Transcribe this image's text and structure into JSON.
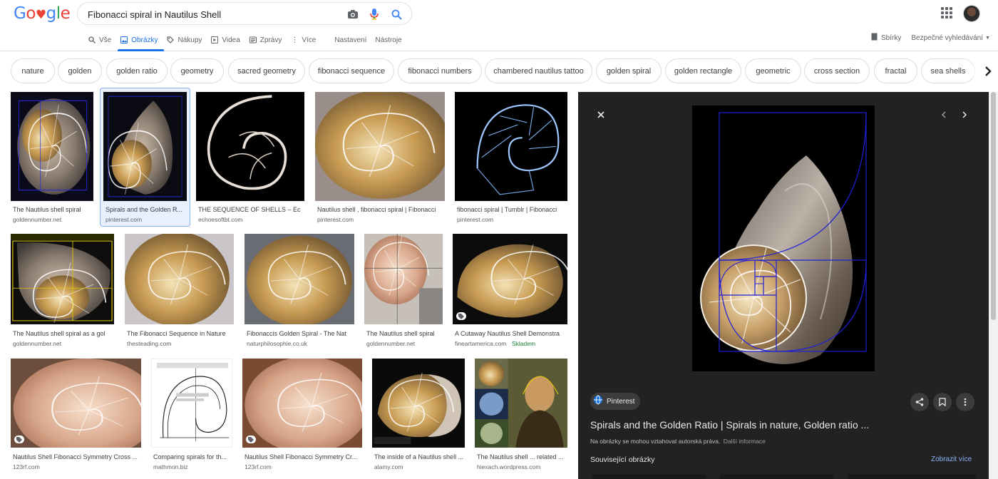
{
  "header": {
    "logo_letters": [
      {
        "ch": "G",
        "color": "#4285f4"
      },
      {
        "ch": "o",
        "color": "#ea4335"
      },
      {
        "ch": "♥",
        "color": "#ea4335"
      },
      {
        "ch": "g",
        "color": "#4285f4"
      },
      {
        "ch": "l",
        "color": "#34a853"
      },
      {
        "ch": "e",
        "color": "#ea4335"
      }
    ],
    "search_value": "Fibonacci spiral in Nautilus Shell",
    "tabs": [
      {
        "icon": "search-icon",
        "label": "Vše"
      },
      {
        "icon": "image-icon",
        "label": "Obrázky",
        "active": true
      },
      {
        "icon": "tag-icon",
        "label": "Nákupy"
      },
      {
        "icon": "play-icon",
        "label": "Videa"
      },
      {
        "icon": "news-icon",
        "label": "Zprávy"
      },
      {
        "icon": "more-icon",
        "label": "Více"
      },
      {
        "icon": "",
        "label": "Nastavení"
      },
      {
        "icon": "",
        "label": "Nástroje"
      }
    ],
    "right_links": [
      "Sbírky",
      "Bezpečné vyhledávání"
    ]
  },
  "chips": [
    "nature",
    "golden",
    "golden ratio",
    "geometry",
    "sacred geometry",
    "fibonacci sequence",
    "fibonacci numbers",
    "chambered nautilus tattoo",
    "golden spiral",
    "golden rectangle",
    "geometric",
    "cross section",
    "fractal",
    "sea shells"
  ],
  "results": [
    {
      "caption": "The Nautilus shell spiral",
      "source": "goldennumber.net",
      "tag": false
    },
    {
      "caption": "Spirals and the Golden R...",
      "source": "pinterest.com",
      "tag": false
    },
    {
      "caption": "THE SEQUENCE OF SHELLS – Ec",
      "source": "echoesoftbt.com",
      "tag": false
    },
    {
      "caption": "Nautilus shell , fibonacci spiral | Fibonacci",
      "source": "pinterest.com",
      "tag": false
    },
    {
      "caption": "fibonacci spiral | Tumblr | Fibonacci",
      "source": "pinterest.com",
      "tag": false
    },
    {
      "caption": "The Nautilus shell spiral as a gol",
      "source": "goldennumber.net",
      "tag": false
    },
    {
      "caption": "The Fibonacci Sequence in Nature",
      "source": "thesteading.com",
      "tag": false
    },
    {
      "caption": "Fibonaccis Golden Spiral - The Nat",
      "source": "naturphilosophie.co.uk",
      "tag": false
    },
    {
      "caption": "The Nautilus shell spiral",
      "source": "goldennumber.net",
      "tag": false
    },
    {
      "caption": "A Cutaway Nautilus Shell Demonstra",
      "source": "fineartamerica.com",
      "extra": "Skladem",
      "tag": true
    },
    {
      "caption": "Nautilus Shell Fibonacci Symmetry Cross ...",
      "source": "123rf.com",
      "tag": true
    },
    {
      "caption": "Comparing spirals for th...",
      "source": "mathmon.biz",
      "tag": false
    },
    {
      "caption": "Nautilus Shell Fibonacci Symmetry Cr...",
      "source": "123rf.com",
      "tag": true
    },
    {
      "caption": "The inside of a Nautilus shell ...",
      "source": "alamy.com",
      "tag": false
    },
    {
      "caption": "The Nautilus shell ... related ...",
      "source": "hiexach.wordpress.com",
      "tag": false
    }
  ],
  "panel": {
    "site_name": "Pinterest",
    "title": "Spirals and the Golden Ratio | Spirals in nature, Golden ratio ...",
    "copyright": "Na obrázky se mohou vztahovat autorská práva.",
    "more_info": "Další informace",
    "related_label": "Související obrázky",
    "see_more": "Zobrazit více"
  },
  "colors": {
    "accent": "#1a73e8",
    "panel_bg": "#222222",
    "guide_blue": "#1f1fd6"
  }
}
